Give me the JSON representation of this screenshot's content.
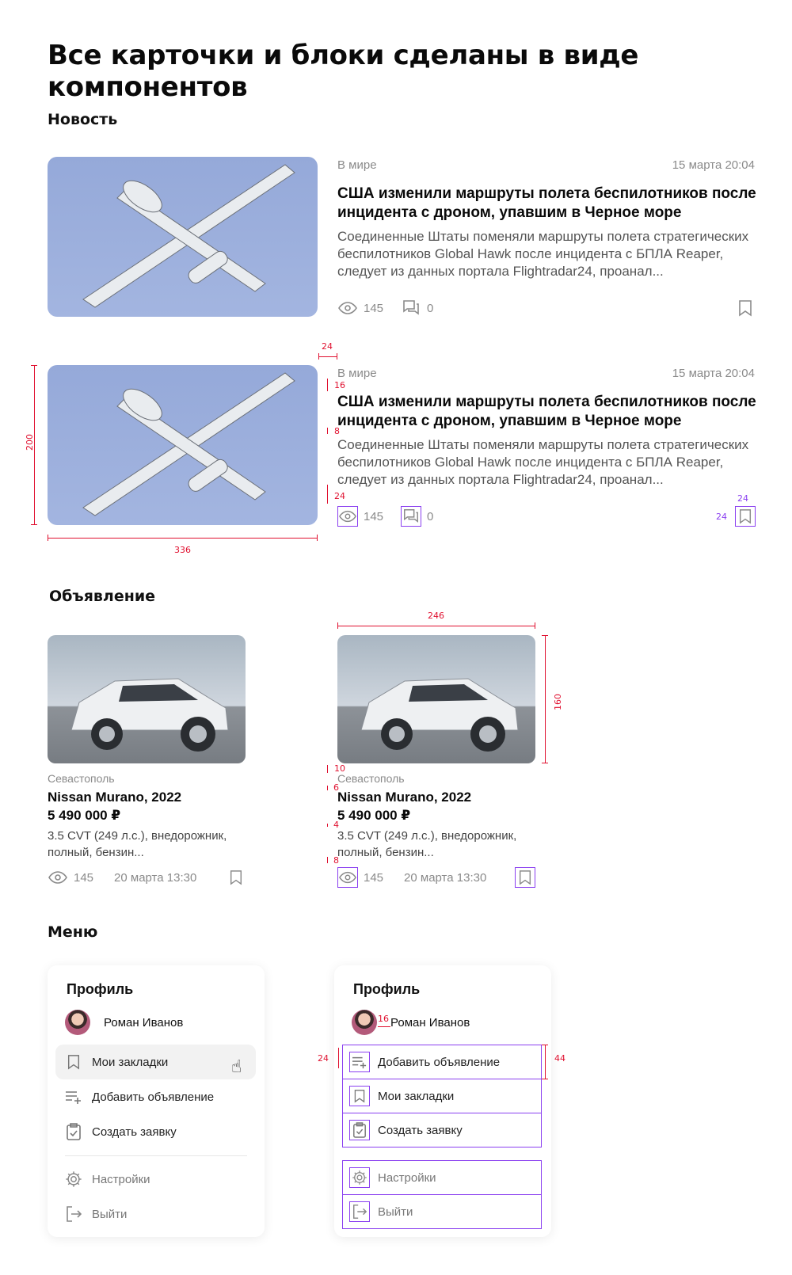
{
  "page_title": "Все карточки и блоки сделаны в виде компонентов",
  "sections": {
    "news": "Новость",
    "ads": "Объявление",
    "menu": "Меню"
  },
  "news_card": {
    "category": "В мире",
    "date": "15 марта 20:04",
    "title": "США изменили маршруты полета беспилотников после инцидента с  дроном, упавшим в Черное море",
    "text": "Соединенные Штаты поменяли маршруты полета стратегических беспилотников Global Hawk после инцидента с БПЛА Reaper, следует из данных портала Flightradar24, проанал...",
    "views": "145",
    "comments": "0",
    "icons": [
      "eye-icon",
      "comment-icon",
      "bookmark-icon"
    ]
  },
  "news_dims": {
    "img_h": "200",
    "img_w": "336",
    "gap": "24",
    "cat_gap": "16",
    "title_gap": "8",
    "meta_gap": "24",
    "bm_w": "24",
    "bm_h": "24"
  },
  "ad_card": {
    "city": "Севастополь",
    "title": "Nissan Murano, 2022",
    "price": "5 490 000 ₽",
    "desc": "3.5 CVT (249 л.с.), внедорожник, полный, бензин...",
    "views": "145",
    "date": "20 марта 13:30",
    "icons": [
      "eye-icon",
      "bookmark-icon"
    ]
  },
  "ad_dims": {
    "img_w": "246",
    "img_h": "160",
    "city_gap": "10",
    "title_gap": "6",
    "desc_gap": "4",
    "meta_gap": "8"
  },
  "menu_left": {
    "title": "Профиль",
    "user": "Роман Иванов",
    "items": [
      {
        "label": "Мои закладки",
        "icon": "bookmark-icon"
      },
      {
        "label": "Добавить объявление",
        "icon": "add-list-icon"
      },
      {
        "label": "Создать заявку",
        "icon": "clipboard-check-icon"
      }
    ],
    "secondary": [
      {
        "label": "Настройки",
        "icon": "gear-icon"
      },
      {
        "label": "Выйти",
        "icon": "logout-icon"
      }
    ]
  },
  "menu_right": {
    "title": "Профиль",
    "user": "Роман Иванов",
    "items": [
      {
        "label": "Добавить объявление",
        "icon": "add-list-icon"
      },
      {
        "label": "Мои закладки",
        "icon": "bookmark-icon"
      },
      {
        "label": "Создать заявку",
        "icon": "clipboard-check-icon"
      }
    ],
    "secondary": [
      {
        "label": "Настройки",
        "icon": "gear-icon"
      },
      {
        "label": "Выйти",
        "icon": "logout-icon"
      }
    ]
  },
  "menu_dims": {
    "avatar_gap": "16",
    "icon_size": "24",
    "item_h": "44"
  },
  "colors": {
    "dimension_red": "#e0102f",
    "component_outline": "#8a3ff0"
  }
}
